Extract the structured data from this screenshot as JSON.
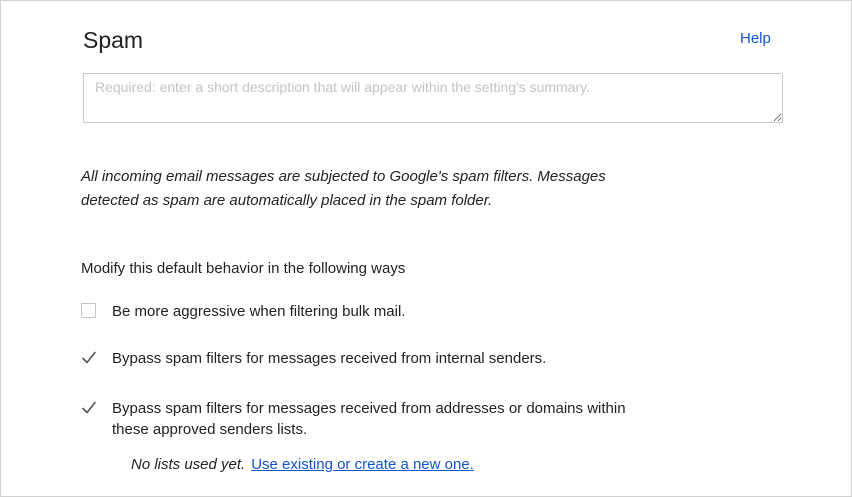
{
  "header": {
    "title": "Spam",
    "help_label": "Help"
  },
  "description": {
    "value": "",
    "placeholder": "Required: enter a short description that will appear within the setting's summary."
  },
  "intro_line1": "All incoming email messages are subjected to Google's spam filters. Messages",
  "intro_line2": "detected as spam are automatically placed in the spam folder.",
  "modify_label": "Modify this default behavior in the following ways",
  "options": [
    {
      "label": "Be more aggressive when filtering bulk mail.",
      "checked": false
    },
    {
      "label": "Bypass spam filters for messages received from internal senders.",
      "checked": true
    },
    {
      "label_line1": "Bypass spam filters for messages received from addresses or domains within",
      "label_line2": "these approved senders lists.",
      "checked": true
    }
  ],
  "approved_lists": {
    "note": "No lists used yet.",
    "link_label": "Use existing or create a new one."
  },
  "colors": {
    "link": "#1155cc",
    "text": "#222222",
    "border": "#c8c8c8",
    "check": "#555555"
  }
}
